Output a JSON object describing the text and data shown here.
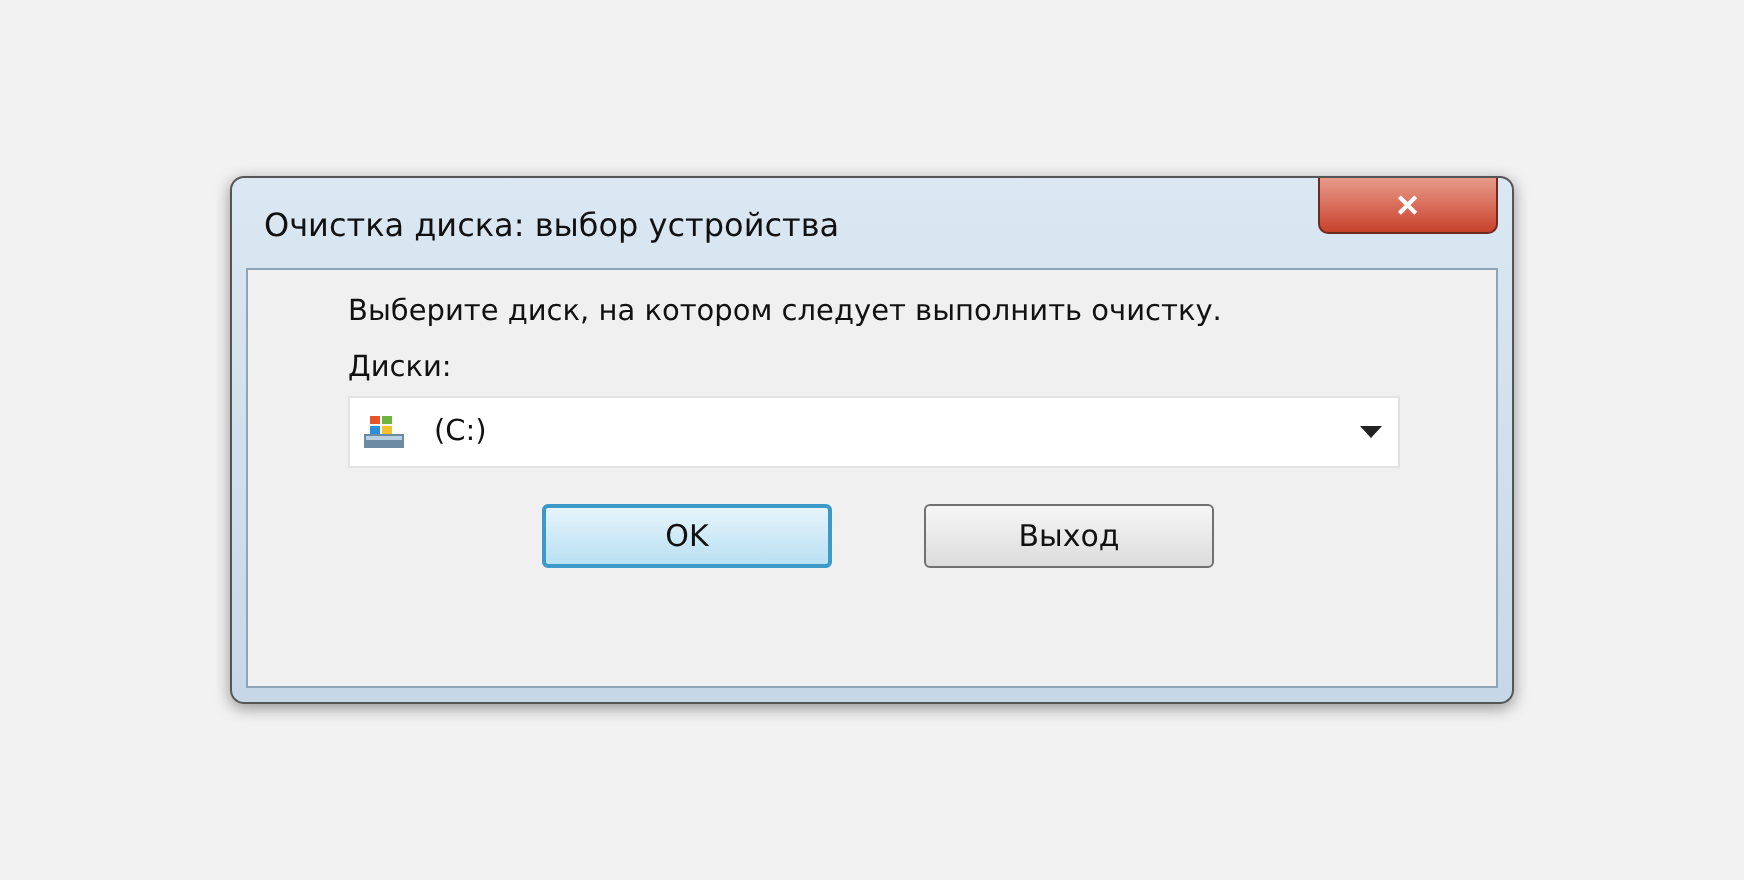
{
  "window": {
    "title": "Очистка диска: выбор устройства",
    "close": "✕"
  },
  "message": "Выберите диск, на котором следует выполнить очистку.",
  "drives_label": "Диски:",
  "drive_select": {
    "value": "(C:)"
  },
  "buttons": [
    {
      "label": "OK",
      "default": true
    },
    {
      "label": "Выход",
      "default": false
    }
  ]
}
